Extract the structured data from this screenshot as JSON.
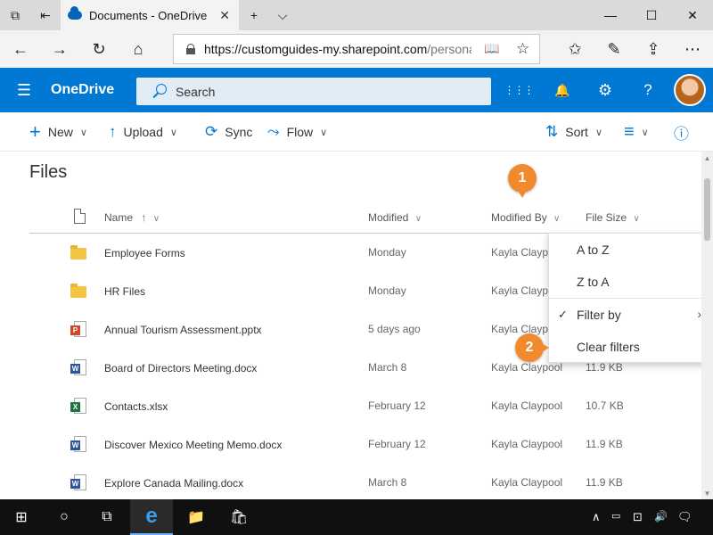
{
  "browser": {
    "tab_title": "Documents - OneDrive",
    "tab_close": "✕",
    "new_tab": "+",
    "tab_menu": "⌵",
    "window_minimize": "—",
    "window_maximize": "☐",
    "window_close": "✕",
    "url_host": "https://customguides-my.sharepoint.com",
    "url_path": "/personal/s",
    "icons": {
      "set_aside": "⧉",
      "back_tabs": "⇤",
      "back": "←",
      "forward": "→",
      "refresh": "↻",
      "home": "⌂",
      "reading_view": "📖",
      "favorite": "☆",
      "favorites_hub": "✩",
      "pen": "✎",
      "share": "⇪",
      "more": "⋯"
    }
  },
  "onedrive": {
    "brand": "OneDrive",
    "waffle": "☰",
    "search_placeholder": "Search",
    "header_icons": {
      "apps": "⋮⋮⋮",
      "bell": "🔔",
      "gear": "⚙",
      "help": "?"
    }
  },
  "commands": {
    "new_label": "New",
    "new_icon": "+",
    "upload_label": "Upload",
    "upload_icon": "↑",
    "sync_label": "Sync",
    "sync_icon": "⟳",
    "flow_label": "Flow",
    "flow_icon": "⤳",
    "sort_label": "Sort",
    "sort_icon": "⇅",
    "view_icon": "≡",
    "info_icon": "ⓘ",
    "chevron": "∨"
  },
  "files": {
    "title": "Files",
    "columns": {
      "name": "Name",
      "name_sort": "↑",
      "modified": "Modified",
      "modified_by": "Modified By",
      "file_size": "File Size",
      "chevron": "∨"
    },
    "rows": [
      {
        "name": "Employee Forms",
        "type": "folder",
        "modified": "Monday",
        "modified_by": "Kayla Claypool",
        "size": ""
      },
      {
        "name": "HR Files",
        "type": "folder",
        "modified": "Monday",
        "modified_by": "Kayla Claypool",
        "size": ""
      },
      {
        "name": "Annual Tourism Assessment.pptx",
        "type": "pptx",
        "badge": "P",
        "modified": "5 days ago",
        "modified_by": "Kayla Claypool",
        "size": ""
      },
      {
        "name": "Board of Directors Meeting.docx",
        "type": "docx",
        "badge": "W",
        "modified": "March 8",
        "modified_by": "Kayla Claypool",
        "size": "11.9 KB"
      },
      {
        "name": "Contacts.xlsx",
        "type": "xlsx",
        "badge": "X",
        "modified": "February 12",
        "modified_by": "Kayla Claypool",
        "size": "10.7 KB"
      },
      {
        "name": "Discover Mexico Meeting Memo.docx",
        "type": "docx",
        "badge": "W",
        "modified": "February 12",
        "modified_by": "Kayla Claypool",
        "size": "11.9 KB"
      },
      {
        "name": "Explore Canada Mailing.docx",
        "type": "docx",
        "badge": "W",
        "modified": "March 8",
        "modified_by": "Kayla Claypool",
        "size": "11.9 KB"
      }
    ]
  },
  "dropdown": {
    "a_to_z": "A to Z",
    "z_to_a": "Z to A",
    "filter_by": "Filter by",
    "filter_check": "✓",
    "filter_arrow": "›",
    "clear_filters": "Clear filters"
  },
  "callouts": {
    "one": "1",
    "two": "2"
  },
  "scrollbar": {
    "up": "▲",
    "down": "▼"
  },
  "taskbar": {
    "start": "⊞",
    "cortana": "○",
    "task_view": "⧉",
    "edge": "e",
    "explorer": "📁",
    "store": "🛍",
    "tray_chevron": "∧",
    "network": "⊡",
    "volume": "🔊",
    "notifications": "🗨"
  },
  "colors": {
    "accent": "#0078d4",
    "callout": "#f08a2c",
    "word": "#2b579a",
    "excel": "#217346",
    "powerpoint": "#d24726",
    "folder": "#f4c443"
  }
}
